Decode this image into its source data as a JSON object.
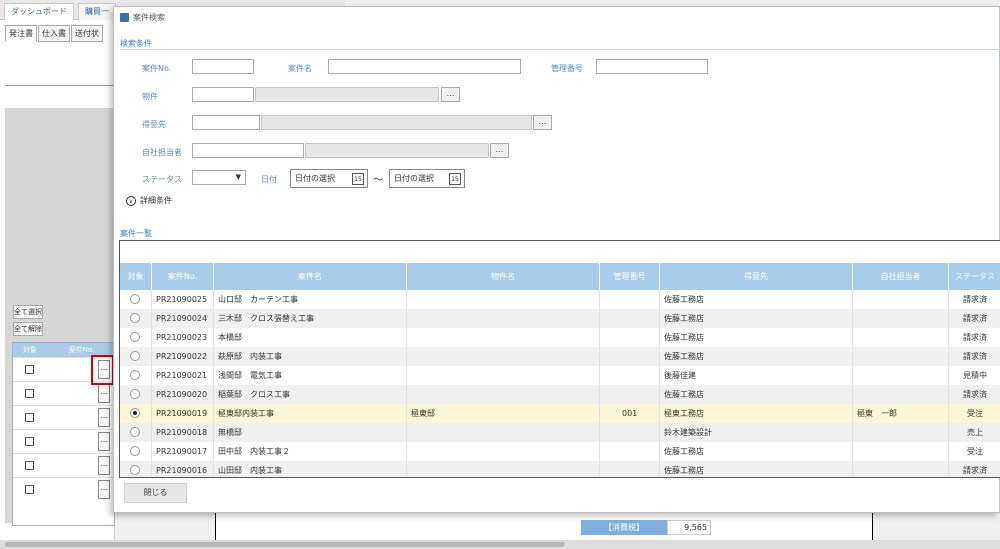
{
  "background": {
    "tabs": [
      "ダッシュボード",
      "購買一"
    ],
    "subtabs": [
      "発注書",
      "仕入書",
      "送付状"
    ],
    "buttons": {
      "select_all": "全て選択",
      "deselect_all": "全て解除"
    },
    "table_headers": [
      "対象",
      "案件No."
    ],
    "tax": {
      "label": "【消費税】",
      "value": "9,565"
    }
  },
  "dialog": {
    "title": "案件検索",
    "search_section": "検索条件",
    "labels": {
      "case_no": "案件No.",
      "case_name": "案件名",
      "mgmt_no": "管理番号",
      "property": "物件",
      "customer": "得意先",
      "staff": "自社担当者",
      "status": "ステータス",
      "date": "日付"
    },
    "date_placeholder": "日付の選択",
    "date_icon": "15",
    "tilde": "～",
    "detail_label": "詳細条件",
    "list_section": "案件一覧",
    "columns": [
      "対象",
      "案件No.",
      "案件名",
      "物件名",
      "管理番号",
      "得意先",
      "自社担当者",
      "ステータス"
    ],
    "rows": [
      {
        "no": "PR21090025",
        "name": "山口邸　カーテン工事",
        "property": "",
        "mgmt": "",
        "customer": "佐藤工務店",
        "staff": "",
        "status": "請求済",
        "selected": false
      },
      {
        "no": "PR21090024",
        "name": "三木邸　クロス張替え工事",
        "property": "",
        "mgmt": "",
        "customer": "佐藤工務店",
        "staff": "",
        "status": "請求済",
        "selected": false
      },
      {
        "no": "PR21090023",
        "name": "本橋邸",
        "property": "",
        "mgmt": "",
        "customer": "佐藤工務店",
        "staff": "",
        "status": "請求済",
        "selected": false
      },
      {
        "no": "PR21090022",
        "name": "萩原邸　内装工事",
        "property": "",
        "mgmt": "",
        "customer": "佐藤工務店",
        "staff": "",
        "status": "請求済",
        "selected": false
      },
      {
        "no": "PR21090021",
        "name": "浅間邸　電気工事",
        "property": "",
        "mgmt": "",
        "customer": "後藤佳建",
        "staff": "",
        "status": "見積中",
        "selected": false
      },
      {
        "no": "PR21090020",
        "name": "稲葉邸　クロス工事",
        "property": "",
        "mgmt": "",
        "customer": "佐藤工務店",
        "staff": "",
        "status": "請求済",
        "selected": false
      },
      {
        "no": "PR21090019",
        "name": "極東邸内装工事",
        "property": "極東邸",
        "mgmt": "001",
        "customer": "極東工務店",
        "staff": "極東　一郎",
        "status": "受注",
        "selected": true
      },
      {
        "no": "PR21090018",
        "name": "無橋邸",
        "property": "",
        "mgmt": "",
        "customer": "鈴木建築設計",
        "staff": "",
        "status": "売上",
        "selected": false
      },
      {
        "no": "PR21090017",
        "name": "田中邸　内装工事２",
        "property": "",
        "mgmt": "",
        "customer": "佐藤工務店",
        "staff": "",
        "status": "受注",
        "selected": false
      },
      {
        "no": "PR21090016",
        "name": "山田邸　内装工事",
        "property": "",
        "mgmt": "",
        "customer": "佐藤工務店",
        "staff": "",
        "status": "請求済",
        "selected": false
      }
    ],
    "close_label": "閉じる"
  }
}
